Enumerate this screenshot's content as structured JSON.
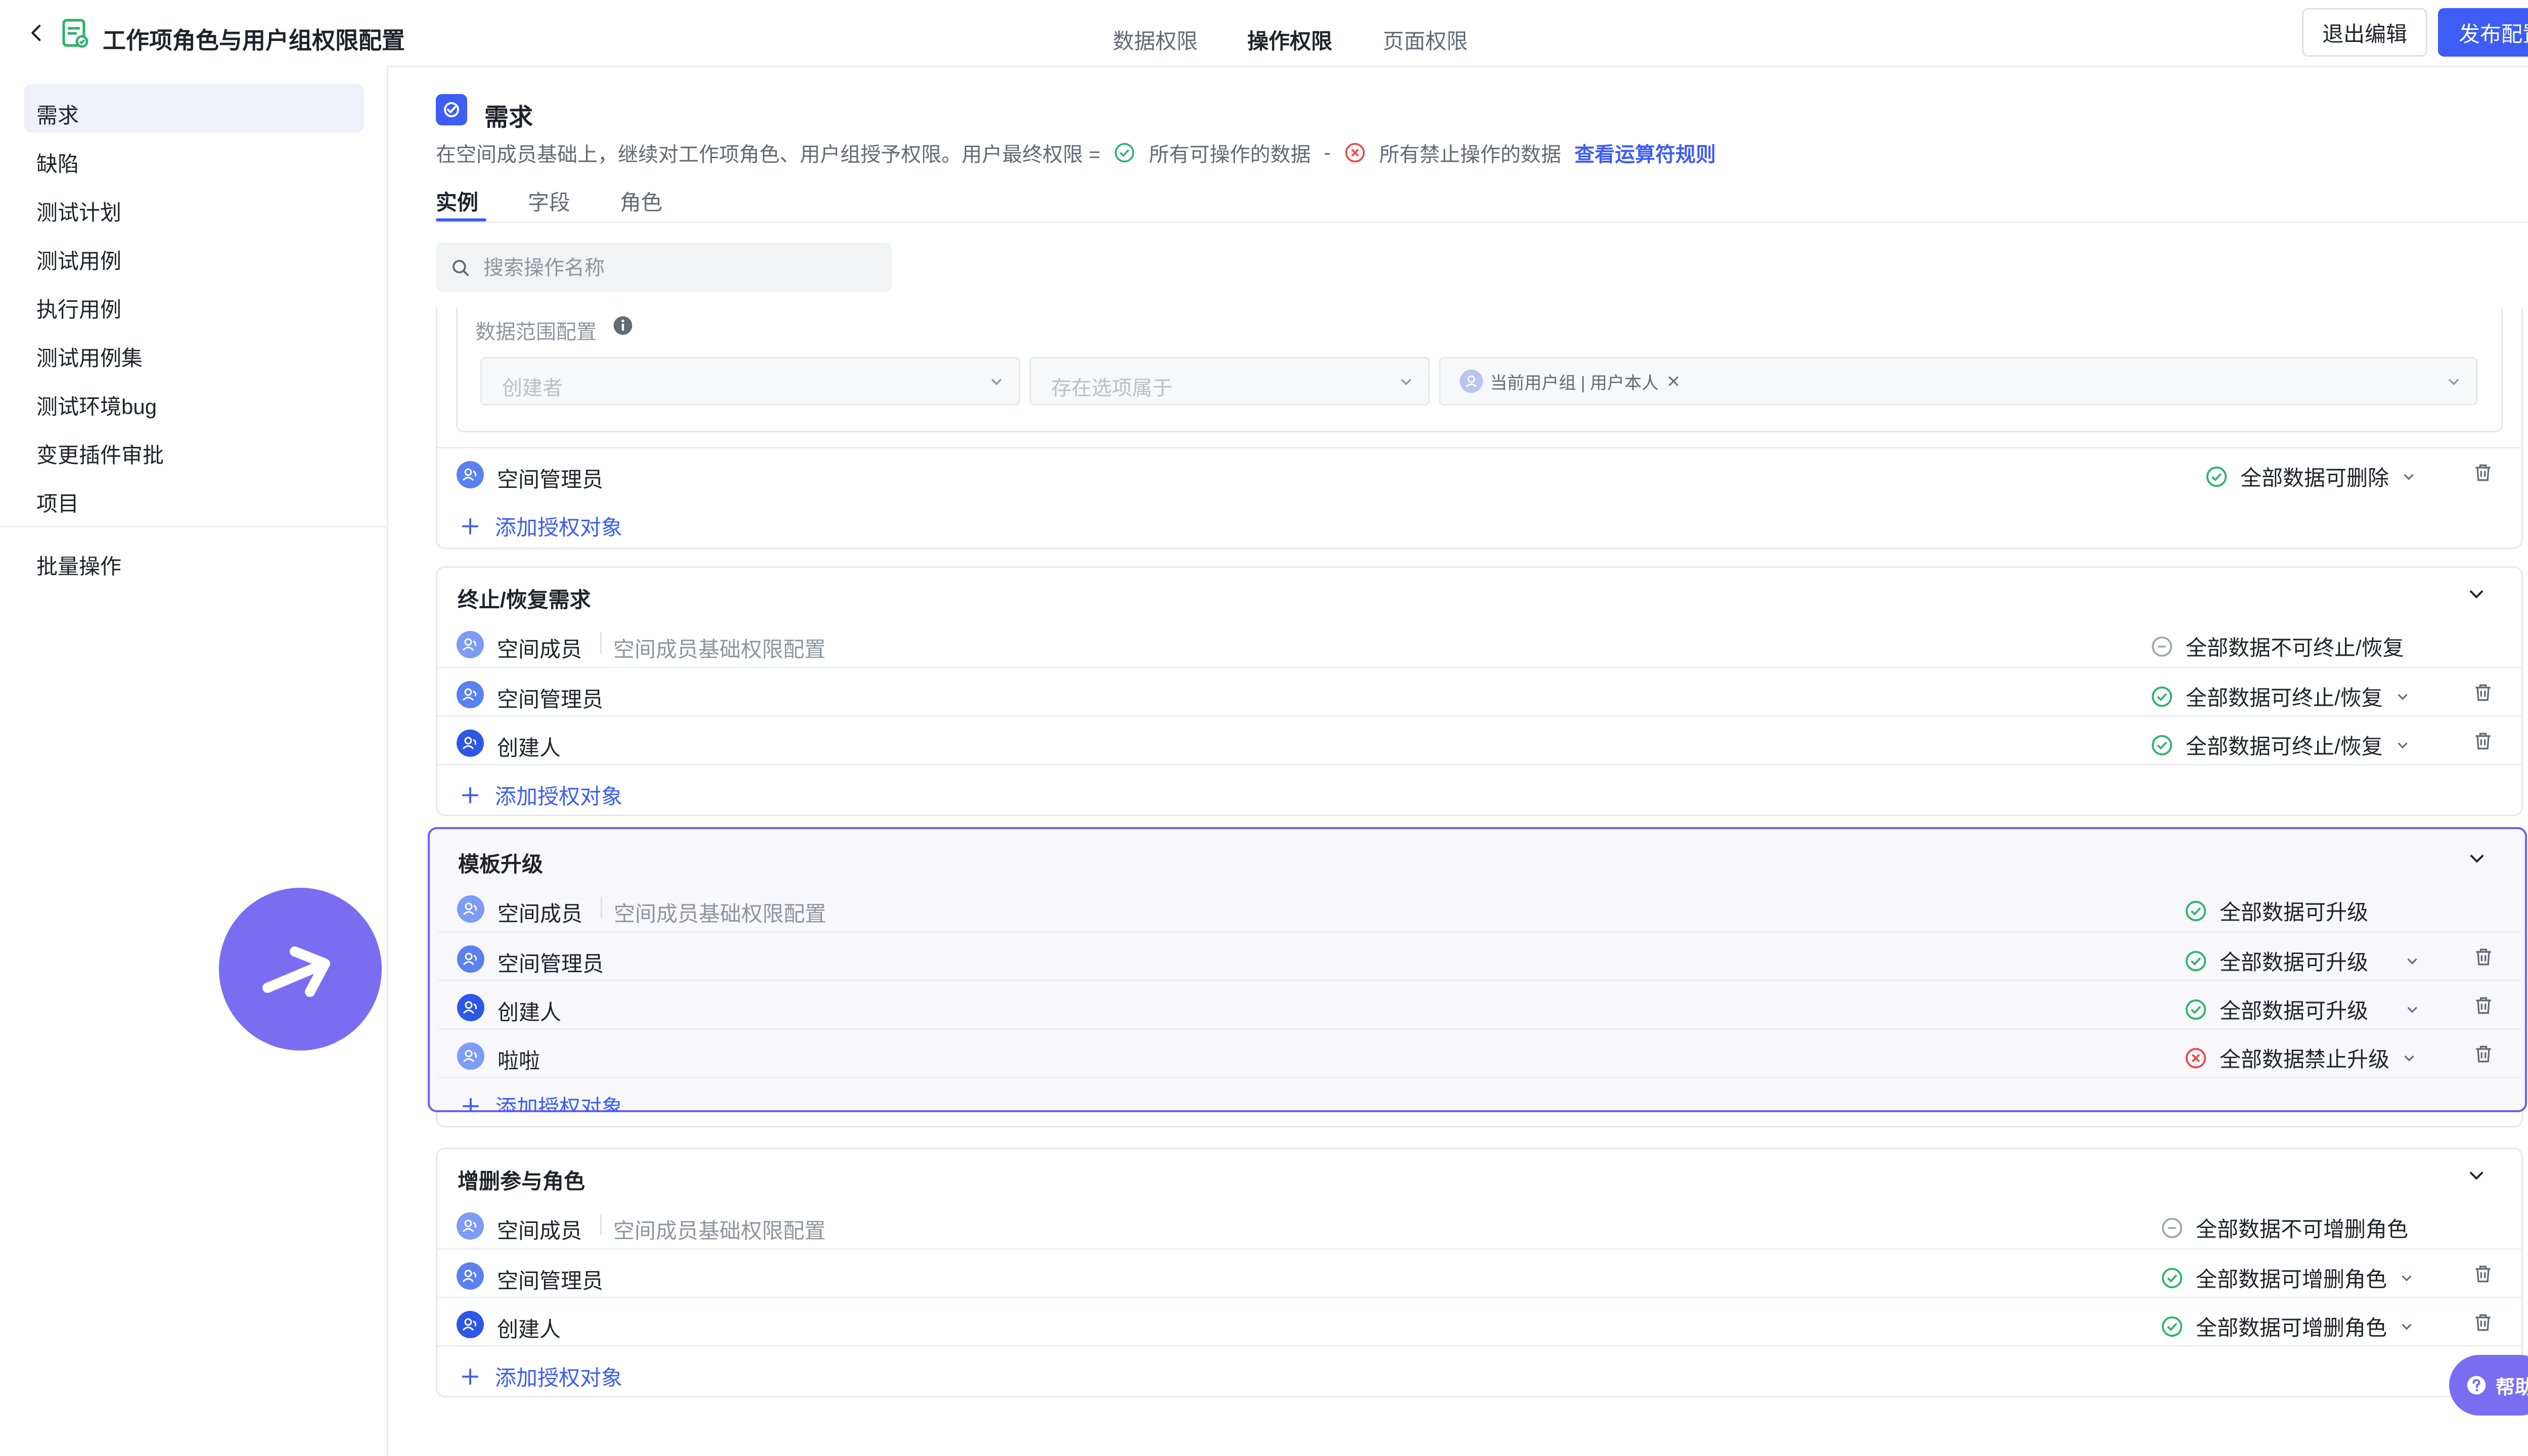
{
  "header": {
    "title": "工作项角色与用户组权限配置",
    "tabs": [
      {
        "label": "数据权限",
        "active": false
      },
      {
        "label": "操作权限",
        "active": true
      },
      {
        "label": "页面权限",
        "active": false
      }
    ],
    "exit_label": "退出编辑",
    "publish_label": "发布配置"
  },
  "sidebar": {
    "items": [
      {
        "label": "需求",
        "active": true
      },
      {
        "label": "缺陷"
      },
      {
        "label": "测试计划"
      },
      {
        "label": "测试用例"
      },
      {
        "label": "执行用例"
      },
      {
        "label": "测试用例集"
      },
      {
        "label": "测试环境bug"
      },
      {
        "label": "变更插件审批"
      },
      {
        "label": "项目"
      }
    ],
    "batch_label": "批量操作"
  },
  "main": {
    "title": "需求",
    "desc_prefix": "在空间成员基础上，继续对工作项角色、用户组授予权限。用户最终权限 =",
    "desc_allow": "所有可操作的数据",
    "desc_minus": "-",
    "desc_deny": "所有禁止操作的数据",
    "desc_link": "查看运算符规则",
    "subtabs": [
      {
        "label": "实例",
        "active": true
      },
      {
        "label": "字段"
      },
      {
        "label": "角色"
      }
    ],
    "search_placeholder": "搜索操作名称",
    "scope": {
      "label": "数据范围配置",
      "select1_placeholder": "创建者",
      "select2_placeholder": "存在选项属于",
      "tag_label": "当前用户组 | 用户本人"
    },
    "delete_card": {
      "row": {
        "role": "空间管理员",
        "status": "全部数据可删除"
      },
      "add_label": "添加授权对象"
    },
    "cards": [
      {
        "title": "终止/恢复需求",
        "rows": [
          {
            "role": "空间成员",
            "sub": "空间成员基础权限配置",
            "status": "全部数据不可终止/恢复"
          },
          {
            "role": "空间管理员",
            "status": "全部数据可终止/恢复"
          },
          {
            "role": "创建人",
            "status": "全部数据可终止/恢复"
          }
        ],
        "add_label": "添加授权对象"
      },
      {
        "title": "模板升级",
        "rows": [
          {
            "role": "空间成员",
            "sub": "空间成员基础权限配置",
            "status": "全部数据可升级"
          },
          {
            "role": "空间管理员",
            "status": "全部数据可升级"
          },
          {
            "role": "创建人",
            "status": "全部数据可升级"
          },
          {
            "role": "啦啦",
            "status": "全部数据禁止升级"
          }
        ],
        "add_label": "添加授权对象"
      },
      {
        "title": "增删参与角色",
        "rows": [
          {
            "role": "空间成员",
            "sub": "空间成员基础权限配置",
            "status": "全部数据不可增删角色"
          },
          {
            "role": "空间管理员",
            "status": "全部数据可增删角色"
          },
          {
            "role": "创建人",
            "status": "全部数据可增删角色"
          }
        ],
        "add_label": "添加授权对象"
      }
    ]
  },
  "help_label": "帮助",
  "colors": {
    "accent": "#3d5df6",
    "allow": "#2fb36b",
    "deny": "#f04848",
    "neutral": "#9aa0a8",
    "selection": "#6f5ff0",
    "help": "#7b6df2"
  }
}
